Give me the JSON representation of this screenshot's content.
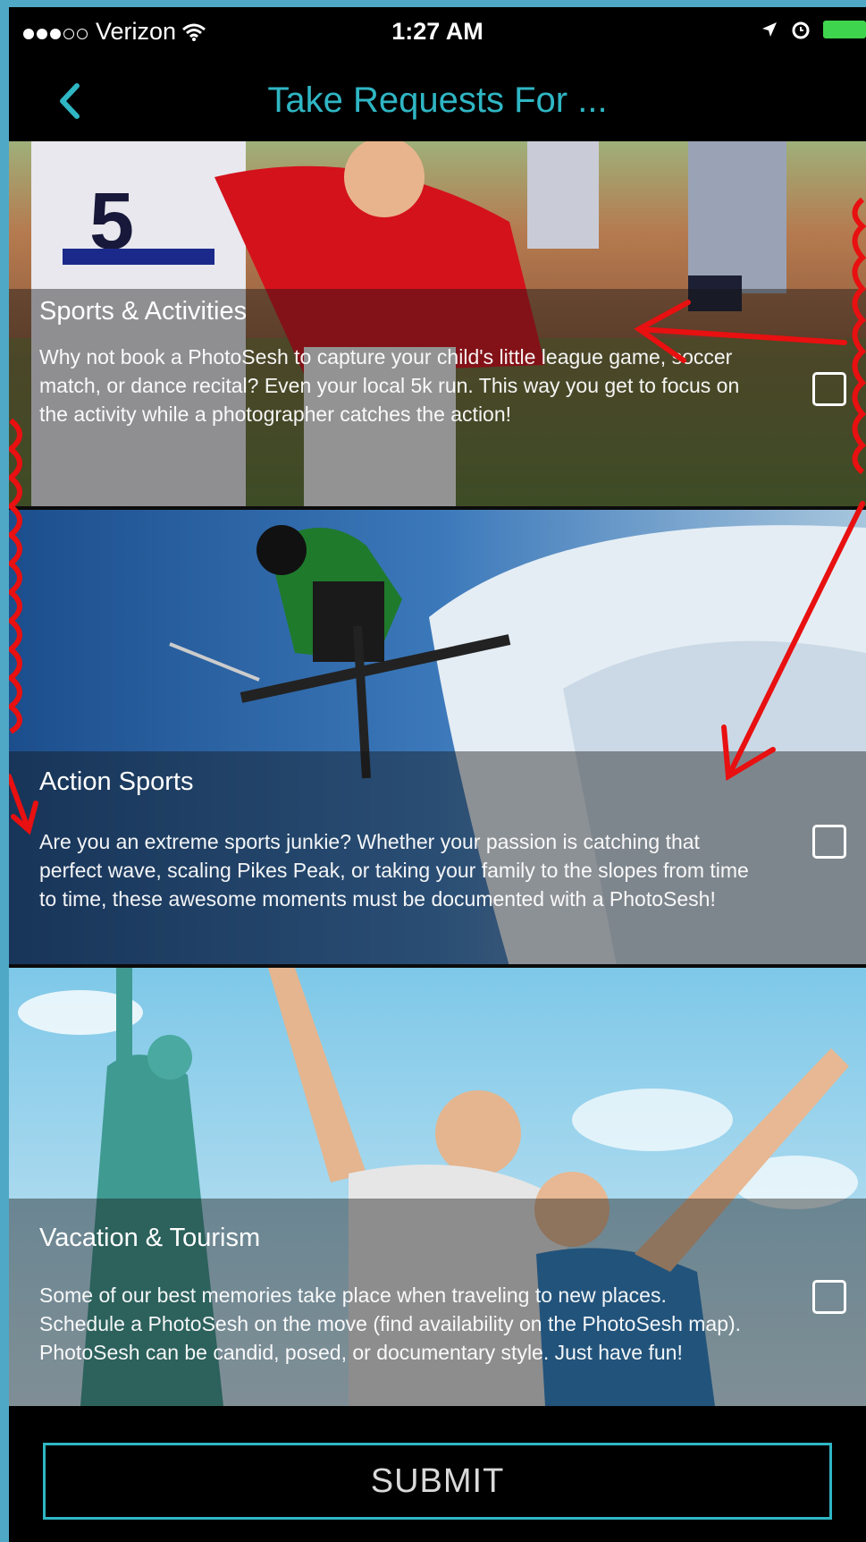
{
  "status_bar": {
    "carrier": "Verizon",
    "signal_icon": "signal-dots",
    "wifi_icon": "wifi-icon",
    "time": "1:27 AM",
    "location_icon": "location-arrow-icon",
    "alarm_icon": "alarm-clock-icon",
    "battery_icon": "battery-icon",
    "battery_color": "#3fd44d"
  },
  "nav": {
    "title": "Take Requests For ...",
    "back_icon": "chevron-left-icon",
    "accent_color": "#2fb6c4"
  },
  "categories": [
    {
      "title": "Sports & Activities",
      "description": "Why not book a PhotoSesh to capture your child's little league game, soccer match, or dance recital? Even your local 5k run. This way you get to focus on the activity while a photographer catches the action!",
      "checked": false
    },
    {
      "title": "Action Sports",
      "description": "Are you an extreme sports junkie? Whether your passion is catching that perfect wave, scaling Pikes Peak, or taking your family to the slopes from time to time, these awesome moments must be documented with a PhotoSesh!",
      "checked": false
    },
    {
      "title": "Vacation & Tourism",
      "description": "Some of our best memories take place when traveling to new places. Schedule a PhotoSesh on the move (find availability on the PhotoSesh map). PhotoSesh can be candid, posed, or documentary style. Just have fun!",
      "checked": false
    }
  ],
  "submit_label": "SUBMIT",
  "annotation_color": "#e81010"
}
